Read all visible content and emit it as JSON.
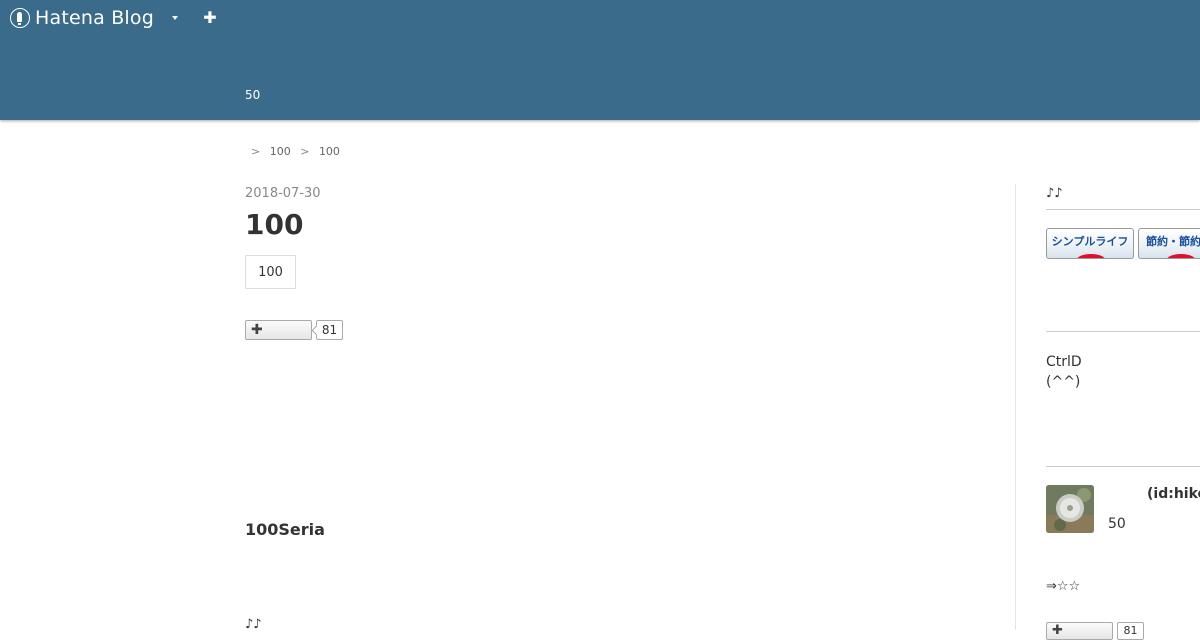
{
  "topbar": {
    "logo_text": "Hatena Blog",
    "icons": [
      "hatena-blog-logo-icon",
      "chevron-down-icon",
      "plus-icon"
    ],
    "background_color": "#3a6b8a"
  },
  "header": {
    "description": "50"
  },
  "breadcrumb": {
    "separator": ">",
    "items": [
      "100",
      "100"
    ]
  },
  "article": {
    "date": "2018-07-30",
    "title": "100",
    "category": "100",
    "bookmark": {
      "button_icon": "plus-icon",
      "count": "81"
    },
    "section_heading": "100Seria",
    "text": "♪♪"
  },
  "sidebar": {
    "title": "♪♪",
    "banners": [
      {
        "label": "シンプルライフ",
        "accent": "#e0102a"
      },
      {
        "label": "節約・節約",
        "accent": "#e0102a"
      }
    ],
    "about_text_lines": [
      "CtrlD",
      "(^^)"
    ],
    "profile": {
      "avatar_icon": "dandelion-avatar-icon",
      "id": "(id:hike",
      "count": "50"
    },
    "arrow_text": "⇒☆☆",
    "bookmark": {
      "button_icon": "plus-icon",
      "count": "81"
    }
  }
}
